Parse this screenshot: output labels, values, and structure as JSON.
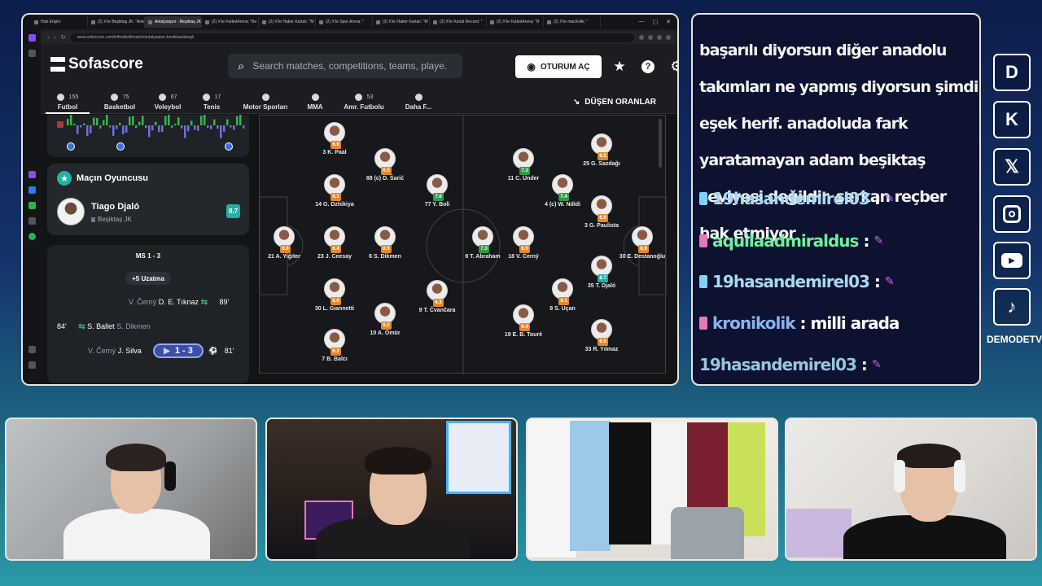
{
  "browser": {
    "tabs": [
      {
        "label": "Hub Erişim",
        "active": false
      },
      {
        "label": "(2) X'te Beşiktaş JK: \"Antal",
        "active": false
      },
      {
        "label": "Antalyaspor - Beşiktaş JK",
        "active": true
      },
      {
        "label": "(2) X'te FutbolArena: \"Be",
        "active": false
      },
      {
        "label": "(2) X'te Haber Kartalı: \"M",
        "active": false
      },
      {
        "label": "(2) X'te Spor Arena: \"",
        "active": false
      },
      {
        "label": "(2) X'te Haber Kartalı: \"M",
        "active": false
      },
      {
        "label": "(2) X'te Kartal Record: \"",
        "active": false
      },
      {
        "label": "(2) X'te FutbolArena: \"B",
        "active": false
      },
      {
        "label": "(2) X'te macKolik: \"",
        "active": false
      }
    ],
    "url": "www.sofascore.com/tr/football/match/antalyaspor-besiktas/absgb"
  },
  "site": {
    "logo": "Sofascore",
    "search_placeholder": "Search matches, competitions, teams, playe...",
    "login_label": "OTURUM AÇ",
    "dropping_odds": "DÜŞEN ORANLAR",
    "sports": [
      {
        "label": "Futbol",
        "count": "155",
        "active": true
      },
      {
        "label": "Basketbol",
        "count": "75",
        "active": false
      },
      {
        "label": "Voleybol",
        "count": "67",
        "active": false
      },
      {
        "label": "Tenis",
        "count": "17",
        "active": false
      },
      {
        "label": "Motor Sporları",
        "count": "",
        "active": false
      },
      {
        "label": "MMA",
        "count": "",
        "active": false
      },
      {
        "label": "Amr. Futbolu",
        "count": "53",
        "active": false
      },
      {
        "label": "Daha F...",
        "count": "",
        "active": false
      }
    ],
    "motm": {
      "title": "Maçın Oyuncusu",
      "name": "Tiago Djaló",
      "team": "Beşiktaş JK",
      "rating": "8.7"
    },
    "events": {
      "ft": "MS 1 - 3",
      "extra_time": "+5 Uzatma",
      "rows": [
        {
          "in": "V. Černý",
          "out": "D. E. Tıknaz",
          "minute": "89'"
        },
        {
          "in": "S. Ballet",
          "out": "S. Dikmen",
          "minute": "84'"
        },
        {
          "in": "V. Černý",
          "out": "J. Silva",
          "minute": "81'"
        }
      ],
      "score": "1 - 3"
    }
  },
  "lineup": [
    {
      "name": "3 K. Paal",
      "rating": "6.0",
      "color": "or"
    },
    {
      "name": "14 G. Dzhikiya",
      "rating": "6.1",
      "color": "or"
    },
    {
      "name": "21 A. Yiğiter",
      "rating": "6.0",
      "color": "or"
    },
    {
      "name": "23 J. Ceesay",
      "rating": "6.4",
      "color": "or"
    },
    {
      "name": "30 L. Giannetti",
      "rating": "6.6",
      "color": "or"
    },
    {
      "name": "7 B. Balcı",
      "rating": "6.3",
      "color": "or"
    },
    {
      "name": "88 (c) D. Šarić",
      "rating": "6.5",
      "color": "or"
    },
    {
      "name": "6 S. Dikmen",
      "rating": "6.5",
      "color": "or"
    },
    {
      "name": "10 A. Ömür",
      "rating": "6.2",
      "color": "or"
    },
    {
      "name": "77 Y. Boli",
      "rating": "7.6",
      "color": "gr"
    },
    {
      "name": "9 T. Čvančara",
      "rating": "6.3",
      "color": "or"
    },
    {
      "name": "9 T. Abraham",
      "rating": "7.3",
      "color": "gr"
    },
    {
      "name": "11 C. Ünder",
      "rating": "7.3",
      "color": "gr"
    },
    {
      "name": "18 V. Černý",
      "rating": "6.5",
      "color": "or"
    },
    {
      "name": "19 E. B. Touré",
      "rating": "6.4",
      "color": "or"
    },
    {
      "name": "4 (c) W. Ndidi",
      "rating": "7.4",
      "color": "gr"
    },
    {
      "name": "8 S. Uçan",
      "rating": "6.1",
      "color": "or"
    },
    {
      "name": "25 G. Sazdağı",
      "rating": "6.5",
      "color": "or"
    },
    {
      "name": "3 G. Paulista",
      "rating": "6.9",
      "color": "or"
    },
    {
      "name": "35 T. Djaló",
      "rating": "8.7",
      "color": "te"
    },
    {
      "name": "33 R. Yılmaz",
      "rating": "6.5",
      "color": "or"
    },
    {
      "name": "30 E. Destanoğlu",
      "rating": "6.9",
      "color": "or"
    }
  ],
  "chat": {
    "message": "başarılı diyorsun diğer anadolu takımları ne yapmış diyorsun şimdi eşek herif. anadoluda fark yaratamayan adam beşiktaş seviyesi değildir. serkan reçber hak etmiyor",
    "rows": [
      {
        "user": "19hasandemirel03",
        "text": ""
      },
      {
        "user": "aquilaadmiraldus",
        "text": ""
      },
      {
        "user": "19hasandemirel03",
        "text": ""
      },
      {
        "user": "kronikolik",
        "text": "milli arada"
      },
      {
        "user": "19hasandemirel03",
        "text": ""
      }
    ]
  },
  "socials": {
    "items": [
      "dlive-icon",
      "kick-icon",
      "x-icon",
      "instagram-icon",
      "youtube-icon",
      "tiktok-icon"
    ],
    "brand": "DEMODETV"
  },
  "colors": {
    "accent_teal": "#21b1a5",
    "rating_orange": "#e3892b",
    "rating_green": "#2f9b43",
    "chat_bg": "#0d1230"
  }
}
